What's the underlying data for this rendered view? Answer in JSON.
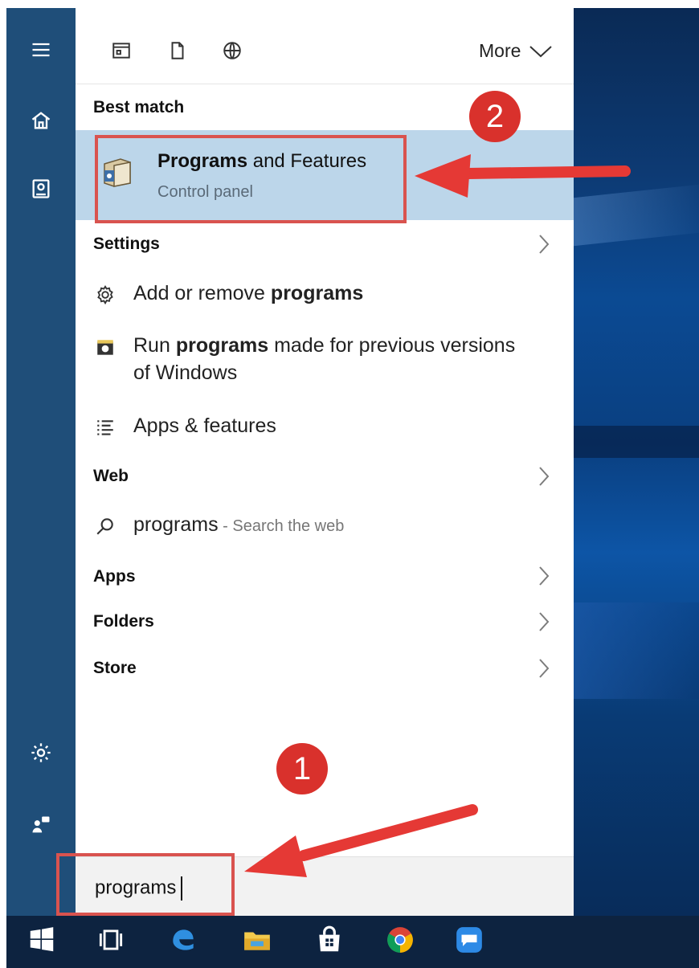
{
  "toolbar": {
    "more_label": "More"
  },
  "sections": {
    "best_match": "Best match",
    "settings": "Settings",
    "web": "Web",
    "apps": "Apps",
    "folders": "Folders",
    "store": "Store"
  },
  "best_match": {
    "title_bold": "Programs",
    "title_rest": " and Features",
    "subtitle": "Control panel"
  },
  "settings_items": {
    "add_remove_pre": "Add or remove ",
    "add_remove_bold": "programs",
    "run_pre": "Run ",
    "run_bold": "programs",
    "run_post": " made for previous versions",
    "run_line2": "of Windows",
    "apps_features": "Apps & features"
  },
  "web_item": {
    "query": "programs",
    "hint": " - Search the web"
  },
  "search": {
    "value": "programs"
  },
  "annotations": {
    "step1": "1",
    "step2": "2"
  },
  "colors": {
    "rail": "#1f4e79",
    "highlight": "#bcd6ea",
    "annotation_red": "#d9534f",
    "taskbar": "#0d2340"
  }
}
